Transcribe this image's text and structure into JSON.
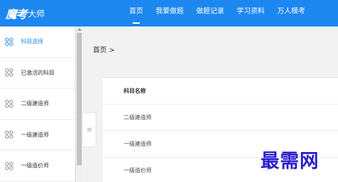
{
  "header": {
    "brand": "魔考",
    "name": "大师",
    "nav": [
      "首页",
      "我要做题",
      "做题记录",
      "学习资料",
      "万人模考"
    ]
  },
  "sidebar": {
    "items": [
      {
        "label": "科目选择",
        "icon": "grid-icon",
        "active": true
      },
      {
        "label": "已激活的科目",
        "icon": "grid-icon"
      },
      {
        "label": "二级建造师",
        "icon": "grid-icon"
      },
      {
        "label": "一级建造师",
        "icon": "grid-icon"
      },
      {
        "label": "一级造价师",
        "icon": "grid-icon"
      }
    ]
  },
  "collapse_glyph": "«",
  "breadcrumb": "首页 >",
  "table": {
    "header": "科目名称",
    "rows": [
      "二级建造师",
      "一级建造师",
      "一级造价师"
    ]
  },
  "watermark": "最需网",
  "colors": {
    "primary": "#1d87f0",
    "watermark": "#2b1fd0"
  }
}
